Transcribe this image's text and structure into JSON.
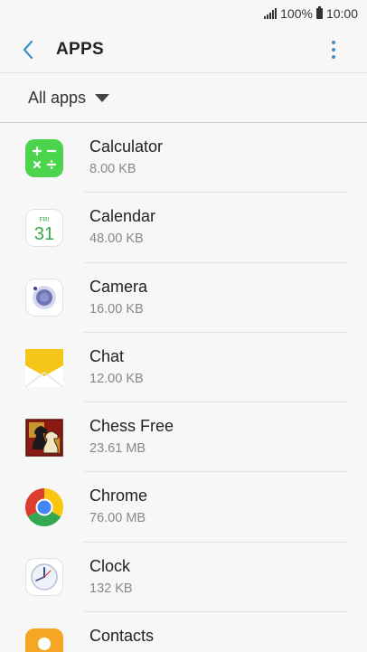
{
  "status": {
    "battery": "100%",
    "time": "10:00"
  },
  "header": {
    "title": "APPS"
  },
  "filter": {
    "label": "All apps"
  },
  "apps": [
    {
      "name": "Calculator",
      "size": "8.00 KB",
      "icon": "calculator-icon"
    },
    {
      "name": "Calendar",
      "size": "48.00 KB",
      "icon": "calendar-icon",
      "icon_day": "FRI",
      "icon_date": "31"
    },
    {
      "name": "Camera",
      "size": "16.00 KB",
      "icon": "camera-icon"
    },
    {
      "name": "Chat",
      "size": "12.00 KB",
      "icon": "envelope-icon"
    },
    {
      "name": "Chess Free",
      "size": "23.61 MB",
      "icon": "chess-knight-icon"
    },
    {
      "name": "Chrome",
      "size": "76.00 MB",
      "icon": "chrome-icon"
    },
    {
      "name": "Clock",
      "size": "132 KB",
      "icon": "clock-icon"
    },
    {
      "name": "Contacts",
      "size": "",
      "icon": "contacts-icon"
    }
  ],
  "colors": {
    "accent": "#3a8fc7",
    "calculator": "#4cd44c",
    "chat": "#f5c518",
    "contacts": "#f5a623"
  }
}
